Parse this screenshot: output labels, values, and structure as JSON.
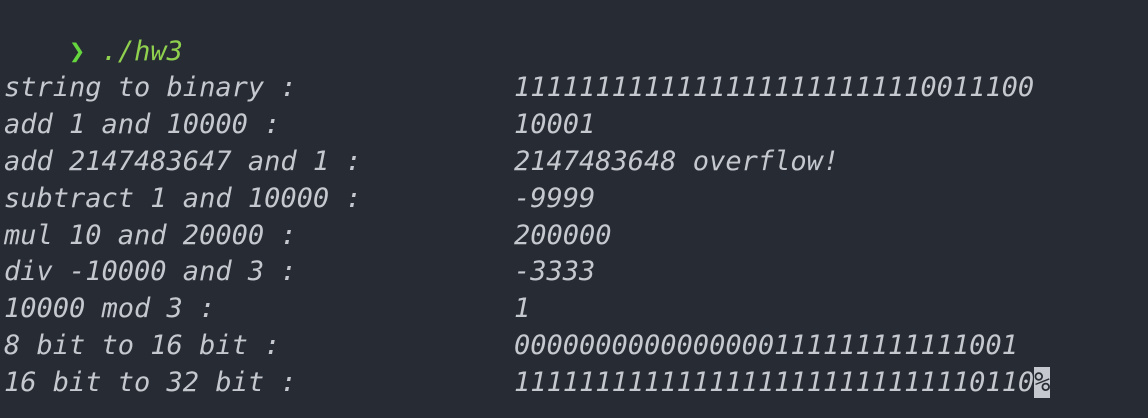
{
  "prompt": {
    "symbol": "❯",
    "command": "./hw3"
  },
  "output": [
    {
      "label": "string to binary :",
      "value": "11111111111111111111111110011100"
    },
    {
      "label": "add 1 and 10000 :",
      "value": "10001"
    },
    {
      "label": "add 2147483647 and 1 :",
      "value": "2147483648 overflow!"
    },
    {
      "label": "subtract 1 and 10000 :",
      "value": "-9999"
    },
    {
      "label": "mul 10 and 20000 :",
      "value": "200000"
    },
    {
      "label": "div -10000 and 3 :",
      "value": "-3333"
    },
    {
      "label": "10000 mod 3 :",
      "value": "1"
    },
    {
      "label": "8 bit to 16 bit :",
      "value": "0000000000000000111111111111001"
    },
    {
      "label": "16 bit to 32 bit :",
      "value": "11111111111111111111111111110110"
    }
  ],
  "end_mark": "%",
  "colors": {
    "background": "#272b33",
    "text": "#c5c8ce",
    "prompt_arrow": "#65d63e",
    "command": "#8fd14f"
  }
}
